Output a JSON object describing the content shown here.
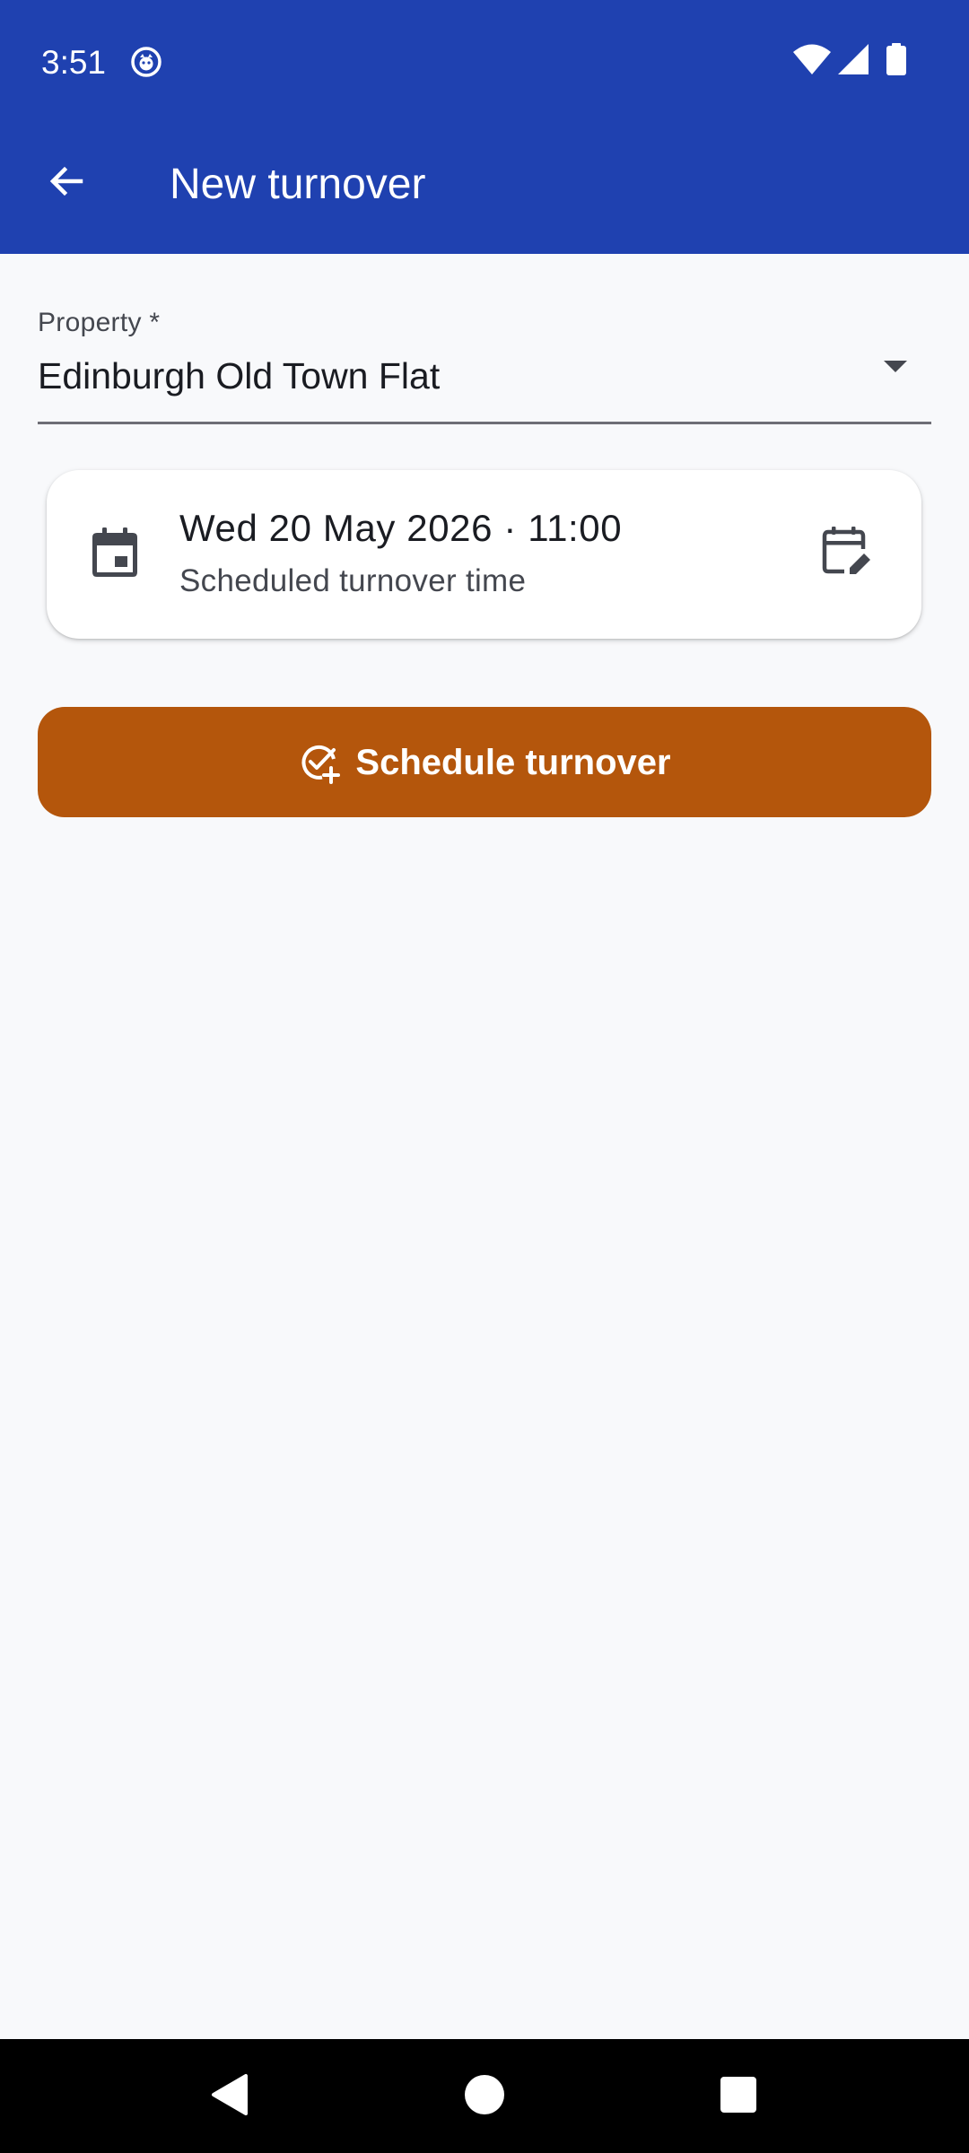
{
  "status_bar": {
    "time": "3:51",
    "icons": [
      "notification-icon",
      "wifi-icon",
      "cellular-signal-icon",
      "battery-icon"
    ]
  },
  "app_bar": {
    "title": "New turnover",
    "back_icon": "arrow-back-icon"
  },
  "form": {
    "property_label": "Property *",
    "property_value": "Edinburgh Old Town Flat",
    "dropdown_icon": "dropdown-caret-icon",
    "date_card": {
      "leading_icon": "calendar-icon",
      "datetime": "Wed 20 May 2026 · 11:00",
      "subtitle": "Scheduled turnover time",
      "trailing_icon": "edit-calendar-icon"
    },
    "submit": {
      "label": "Schedule turnover",
      "icon": "check-circle-add-icon"
    }
  },
  "nav_bar": {
    "icons": [
      "nav-back-icon",
      "nav-home-icon",
      "nav-recents-icon"
    ]
  },
  "colors": {
    "app_bar": "#1f41b0",
    "background": "#f8f9fb",
    "primary_button": "#b4560c",
    "card": "#ffffff",
    "text_primary": "#1a1c22",
    "text_secondary": "#44474f"
  }
}
